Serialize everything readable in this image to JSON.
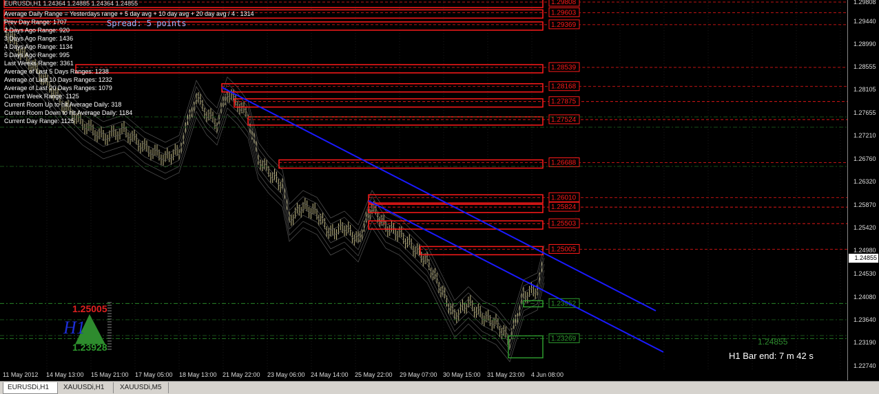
{
  "window": {
    "symbol_title": "EURUSDi,H1  1.24364 1.24885 1.24364 1.24855"
  },
  "stats": [
    "Average Daily Range = Yesterdays range + 5 day avg + 10 day avg + 20 day avg / 4 : 1314",
    "Prev Day Range: 1707",
    "2 Days Ago Range: 920",
    "3 Days Ago Range: 1436",
    "4 Days Ago Range: 1134",
    "5 Days Ago Range: 995",
    "Last Weeks Range: 3361",
    "Average of Last 5 Days Ranges: 1238",
    "Average of Last 10 Days Ranges: 1232",
    "Average of Last 20 Days Ranges: 1079",
    "Current Week Range: 1125",
    "Current Room Up to hit Average Daily:     318",
    "Current Room Down to hit Average Daily: 1184",
    "Current Day Range: 1125"
  ],
  "spread": "Spread: 5 points",
  "price_axis": [
    "1.29808",
    "1.29440",
    "1.28990",
    "1.28555",
    "1.28105",
    "1.27655",
    "1.27210",
    "1.26760",
    "1.26320",
    "1.25870",
    "1.25420",
    "1.24980",
    "1.24530",
    "1.24080",
    "1.23640",
    "1.23190",
    "1.22740"
  ],
  "current_price": "1.24855",
  "time_axis": [
    "11 May 2012",
    "14 May 13:00",
    "15 May 21:00",
    "17 May 05:00",
    "18 May 13:00",
    "21 May 22:00",
    "23 May 06:00",
    "24 May 14:00",
    "25 May 22:00",
    "29 May 07:00",
    "30 May 15:00",
    "31 May 23:00",
    "4 Jun 08:00"
  ],
  "resistance_levels": [
    "1.29808",
    "1.29603",
    "1.29369",
    "1.28539",
    "1.28168",
    "1.27875",
    "1.27524",
    "1.26688",
    "1.26010",
    "1.25824",
    "1.25503",
    "1.25005"
  ],
  "support_levels": [
    "1.23952",
    "1.23269"
  ],
  "indicator": {
    "high": "1.25005",
    "timeframe": "H1",
    "low": "1.23928"
  },
  "big_price": "1.24855",
  "bar_end": "H1 Bar end: 7 m 42 s",
  "tabs": [
    "EURUSDi,H1",
    "XAUUSDi,H1",
    "XAUUSDi,M5"
  ],
  "colors": {
    "resistance": "#ff1a1a",
    "support": "#2e9a2e",
    "trendline": "#1a1aff",
    "candle": "#c8c08a"
  }
}
